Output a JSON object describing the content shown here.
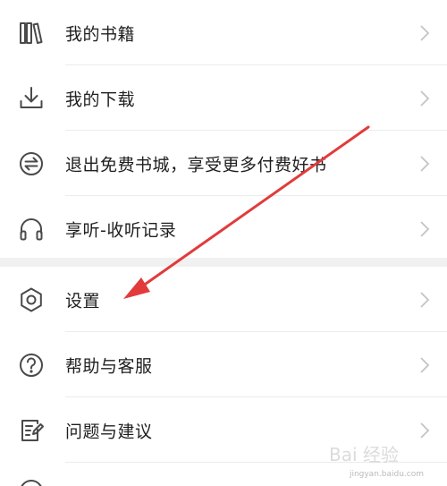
{
  "menu": {
    "group1": [
      {
        "label": "我的书籍",
        "icon": "books-icon"
      },
      {
        "label": "我的下载",
        "icon": "download-icon"
      },
      {
        "label": "退出免费书城，享受更多付费好书",
        "icon": "switch-icon"
      },
      {
        "label": "享听-收听记录",
        "icon": "headphones-icon"
      }
    ],
    "group2": [
      {
        "label": "设置",
        "icon": "gear-icon"
      },
      {
        "label": "帮助与客服",
        "icon": "help-icon"
      },
      {
        "label": "问题与建议",
        "icon": "feedback-icon"
      }
    ]
  },
  "colors": {
    "text": "#1f1f1f",
    "icon": "#4a4a4a",
    "chevron": "#c4c4c4",
    "divider": "#ececec",
    "section_gap": "#f1f1f1",
    "annotation_arrow": "#e23b3b"
  },
  "watermark": {
    "text": "Bai 经验",
    "url": "jingyan.baidu.com"
  }
}
